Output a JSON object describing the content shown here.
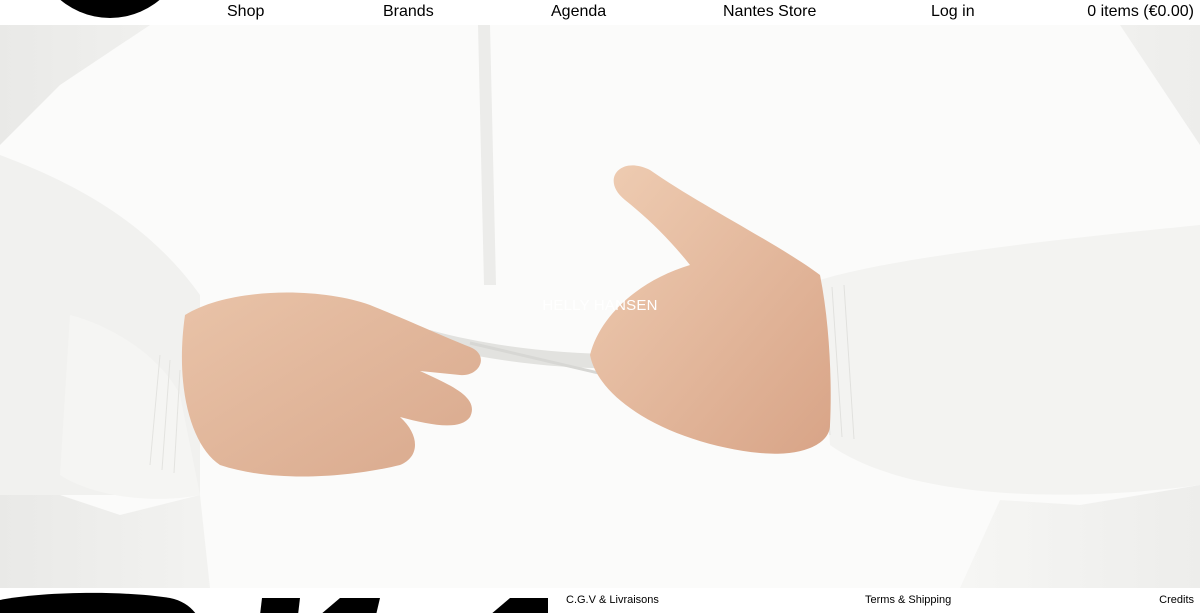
{
  "nav": {
    "shop": "Shop",
    "brands": "Brands",
    "agenda": "Agenda",
    "store": "Nantes Store",
    "login": "Log in",
    "cart": "0 items (€0.00)"
  },
  "hero": {
    "caption": "HELLY HANSEN"
  },
  "footer": {
    "cgv": "C.G.V & Livraisons",
    "terms": "Terms & Shipping",
    "credits": "Credits"
  },
  "colors": {
    "text": "#000000",
    "background": "#ffffff",
    "caption": "#ffffff"
  }
}
